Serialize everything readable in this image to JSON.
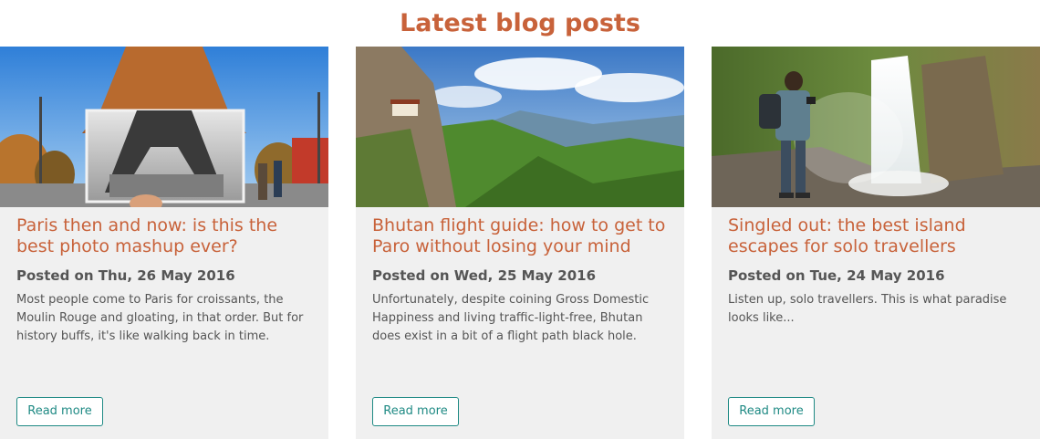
{
  "section": {
    "title": "Latest blog posts"
  },
  "accent_color": "#c8623a",
  "button_color": "#1f8a84",
  "posts": [
    {
      "title": "Paris then and now: is this the best photo mashup ever?",
      "date": "Posted on Thu, 26 May 2016",
      "excerpt": "Most people come to Paris for croissants, the Moulin Rouge and gloating, in that order. But for history buffs, it's like walking back in time.",
      "button": "Read more",
      "image": "eiffel-tower-then-and-now-photo"
    },
    {
      "title": "Bhutan flight guide: how to get to Paro without losing your mind",
      "date": "Posted on Wed, 25 May 2016",
      "excerpt": "Unfortunately, despite coining Gross Domestic Happiness and living traffic-light-free, Bhutan does exist in a bit of a flight path black hole.",
      "button": "Read more",
      "image": "bhutan-mountain-valley-photo"
    },
    {
      "title": "Singled out: the best island escapes for solo travellers",
      "date": "Posted on Tue, 24 May 2016",
      "excerpt": "Listen up, solo travellers. This is what paradise looks like...",
      "button": "Read more",
      "image": "traveller-waterfall-photo"
    }
  ]
}
